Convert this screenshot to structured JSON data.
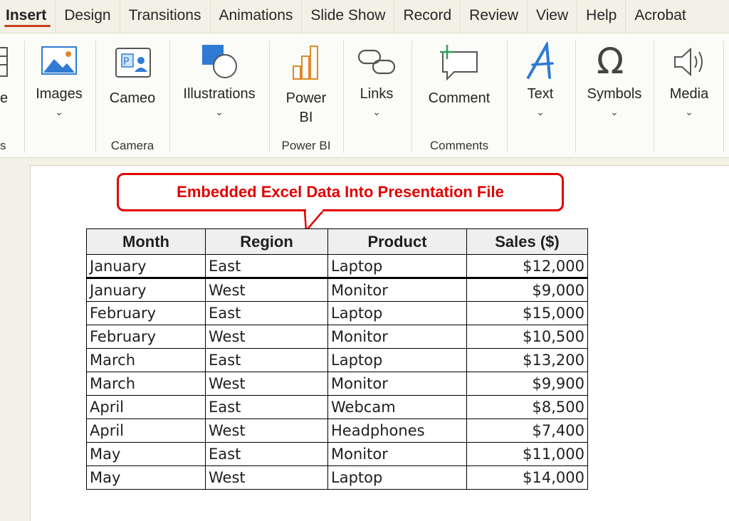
{
  "tabs": [
    {
      "label": "Insert",
      "active": true
    },
    {
      "label": "Design"
    },
    {
      "label": "Transitions"
    },
    {
      "label": "Animations"
    },
    {
      "label": "Slide Show"
    },
    {
      "label": "Record"
    },
    {
      "label": "Review"
    },
    {
      "label": "View"
    },
    {
      "label": "Help"
    },
    {
      "label": "Acrobat"
    }
  ],
  "ribbon": {
    "partial_left_label": "e",
    "partial_left_group": "s",
    "buttons": {
      "images": "Images",
      "cameo": "Cameo",
      "illustrations": "Illustrations",
      "power_bi_line1": "Power",
      "power_bi_line2": "BI",
      "links": "Links",
      "comment": "Comment",
      "text": "Text",
      "symbols": "Symbols",
      "media": "Media"
    },
    "groups": {
      "camera": "Camera",
      "power_bi": "Power BI",
      "comments": "Comments"
    },
    "chevron": "⌄",
    "icons": [
      "images-icon",
      "cameo-icon",
      "illustrations-icon",
      "power-bi-icon",
      "links-icon",
      "comment-icon",
      "text-icon",
      "symbols-icon",
      "media-icon"
    ],
    "colors": {
      "accent": "#c43e1c",
      "icon_blue": "#2f7bd3",
      "icon_orange": "#e0892c"
    }
  },
  "slide": {
    "callout_text": "Embedded Excel Data Into Presentation File",
    "callout_color": "#e20000",
    "table": {
      "headers": [
        "Month",
        "Region",
        "Product",
        "Sales ($)"
      ],
      "rows": [
        [
          "January",
          "East",
          "Laptop",
          "$12,000"
        ],
        [
          "January",
          "West",
          "Monitor",
          "$9,000"
        ],
        [
          "February",
          "East",
          "Laptop",
          "$15,000"
        ],
        [
          "February",
          "West",
          "Monitor",
          "$10,500"
        ],
        [
          "March",
          "East",
          "Laptop",
          "$13,200"
        ],
        [
          "March",
          "West",
          "Monitor",
          "$9,900"
        ],
        [
          "April",
          "East",
          "Webcam",
          "$8,500"
        ],
        [
          "April",
          "West",
          "Headphones",
          "$7,400"
        ],
        [
          "May",
          "East",
          "Monitor",
          "$11,000"
        ],
        [
          "May",
          "West",
          "Laptop",
          "$14,000"
        ]
      ]
    }
  }
}
